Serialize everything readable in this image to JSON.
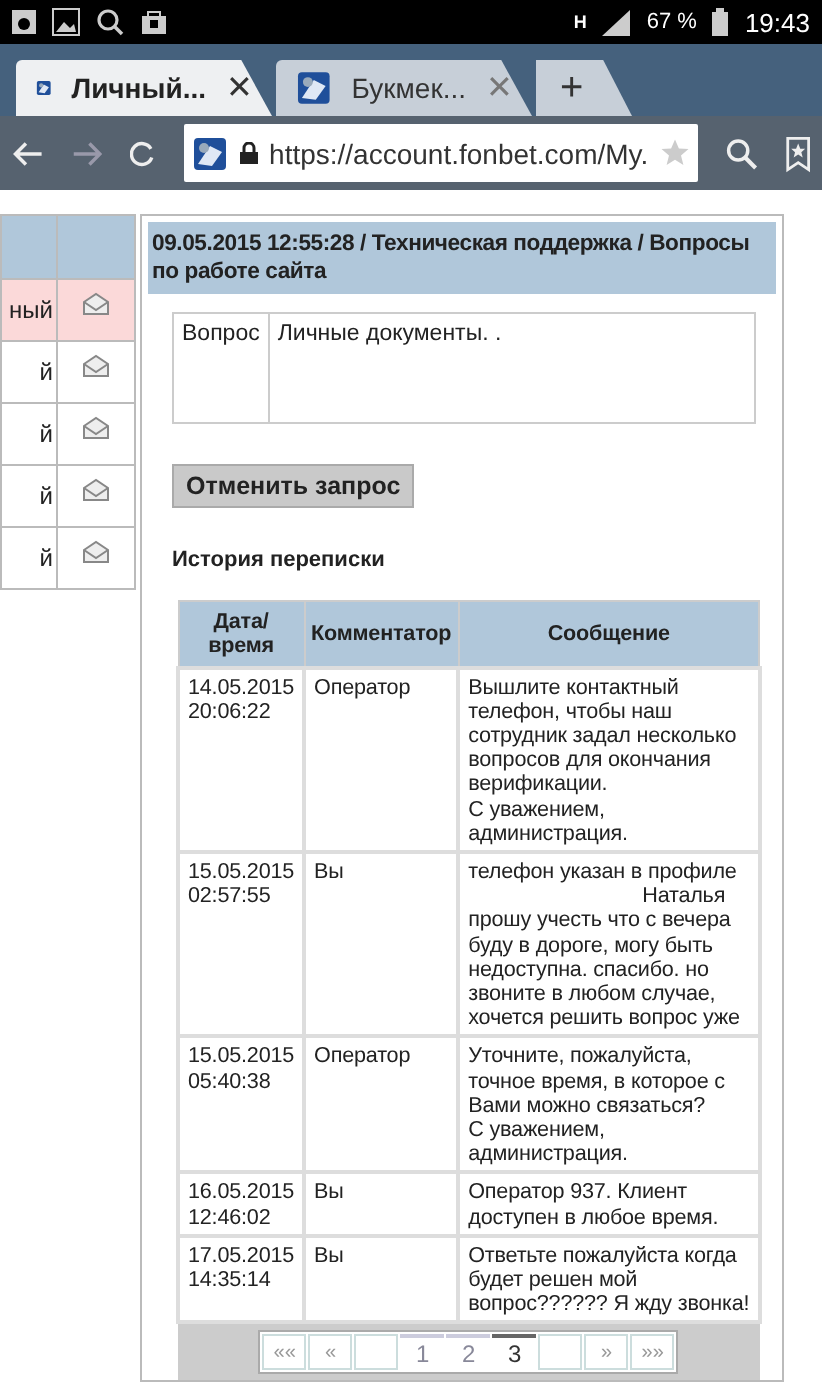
{
  "status_bar": {
    "network": "H",
    "battery": "67 %",
    "time": "19:43"
  },
  "tabs": [
    {
      "label": "Личный...",
      "selected": true,
      "close": "✕"
    },
    {
      "label": "Букмек...",
      "selected": false,
      "close": "✕"
    }
  ],
  "new_tab": "+",
  "address_bar": {
    "url": "https://account.fonbet.com/My."
  },
  "side_table": {
    "rows": [
      {
        "text": "ный",
        "highlighted": true
      },
      {
        "text": "й",
        "highlighted": false
      },
      {
        "text": "й",
        "highlighted": false
      },
      {
        "text": "й",
        "highlighted": false
      },
      {
        "text": "й",
        "highlighted": false
      }
    ]
  },
  "ticket": {
    "title": "09.05.2015 12:55:28 / Техническая поддержка / Вопросы по работе сайта",
    "question_label": "Вопрос",
    "question": "Личные документы. .",
    "cancel_button": "Отменить запрос",
    "history_title": "История переписки",
    "columns": [
      "Дата/\nвремя",
      "Комментатор",
      "Сообщение"
    ],
    "rows": [
      {
        "date": "14.05.2015\n20:06:22",
        "author": "Оператор",
        "message": "Вышлите контактный\nтелефон, чтобы наш\nсотрудник задал несколько\nвопросов для окончания\nверификации.\nС уважением,\nадминистрация."
      },
      {
        "date": "15.05.2015\n02:57:55",
        "author": "Вы",
        "message": "телефон указан в профиле\n                              Наталья\nпрошу учесть что с вечера\nбуду в дороге, могу быть\nнедоступна. спасибо. но\nзвоните в любом случае,\nхочется решить вопрос уже"
      },
      {
        "date": "15.05.2015\n05:40:38",
        "author": "Оператор",
        "message": "Уточните, пожалуйста,\nточное время, в которое с\nВами можно связаться?\nС уважением,\nадминистрация."
      },
      {
        "date": "16.05.2015\n12:46:02",
        "author": "Вы",
        "message": "Оператор 937. Клиент\nдоступен в любое время."
      },
      {
        "date": "17.05.2015\n14:35:14",
        "author": "Вы",
        "message": "Ответьте пожалуйста когда\nбудет решен мой\nвопрос?????? Я жду звонка!"
      }
    ],
    "pager": [
      {
        "kind": "link",
        "label": "««",
        "selected": false
      },
      {
        "kind": "link",
        "label": "«",
        "selected": false
      },
      {
        "kind": "blank",
        "selected": false
      },
      {
        "kind": "link",
        "label": "1",
        "selected": false
      },
      {
        "kind": "link",
        "label": "2",
        "selected": false
      },
      {
        "kind": "link",
        "label": "3",
        "selected": true
      },
      {
        "kind": "blank",
        "selected": false
      },
      {
        "kind": "link",
        "label": "»",
        "selected": false
      },
      {
        "kind": "link",
        "label": "»»",
        "selected": false
      }
    ]
  }
}
